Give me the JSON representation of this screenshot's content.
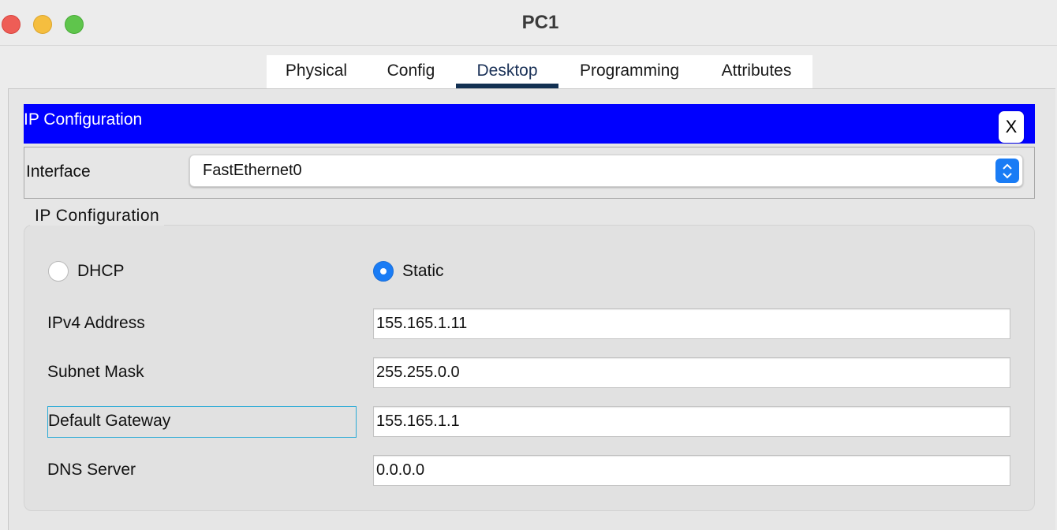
{
  "window": {
    "title": "PC1"
  },
  "tabs": [
    {
      "label": "Physical"
    },
    {
      "label": "Config"
    },
    {
      "label": "Desktop"
    },
    {
      "label": "Programming"
    },
    {
      "label": "Attributes"
    }
  ],
  "active_tab": "Desktop",
  "panel": {
    "title": "IP Configuration",
    "close_label": "X",
    "header_color": "#0000ff"
  },
  "interface": {
    "label": "Interface",
    "selected": "FastEthernet0"
  },
  "ip_config": {
    "group_title": "IP Configuration",
    "dhcp_label": "DHCP",
    "static_label": "Static",
    "mode": "Static",
    "fields": [
      {
        "label": "IPv4 Address",
        "value": "155.165.1.11"
      },
      {
        "label": "Subnet Mask",
        "value": "255.255.0.0"
      },
      {
        "label": "Default Gateway",
        "value": "155.165.1.1"
      },
      {
        "label": "DNS Server",
        "value": "0.0.0.0"
      }
    ]
  },
  "colors": {
    "accent": "#1a7cf5",
    "active_tab_underline": "#123052",
    "focus_border": "#2aaad6"
  }
}
